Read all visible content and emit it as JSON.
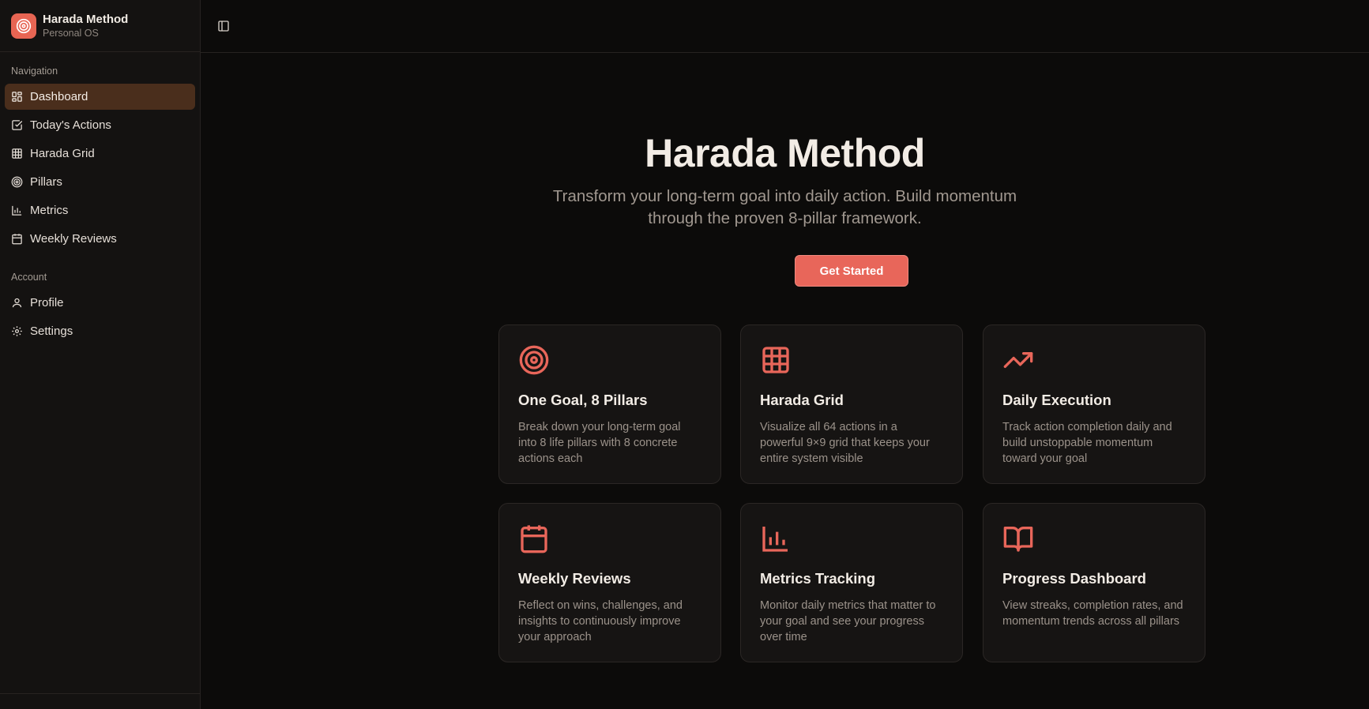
{
  "brand": {
    "title": "Harada Method",
    "subtitle": "Personal OS"
  },
  "sidebar": {
    "navigation_label": "Navigation",
    "navigation": [
      {
        "label": "Dashboard",
        "icon": "dashboard-icon",
        "active": true
      },
      {
        "label": "Today's Actions",
        "icon": "check-square-icon"
      },
      {
        "label": "Harada Grid",
        "icon": "grid-icon"
      },
      {
        "label": "Pillars",
        "icon": "target-icon"
      },
      {
        "label": "Metrics",
        "icon": "bar-chart-icon"
      },
      {
        "label": "Weekly Reviews",
        "icon": "calendar-icon"
      }
    ],
    "account_label": "Account",
    "account": [
      {
        "label": "Profile",
        "icon": "user-icon"
      },
      {
        "label": "Settings",
        "icon": "gear-icon"
      }
    ]
  },
  "hero": {
    "title": "Harada Method",
    "subtitle": "Transform your long-term goal into daily action. Build momentum through the proven 8-pillar framework.",
    "cta": "Get Started"
  },
  "features": [
    {
      "title": "One Goal, 8 Pillars",
      "desc": "Break down your long-term goal into 8 life pillars with 8 concrete actions each",
      "icon": "target-icon"
    },
    {
      "title": "Harada Grid",
      "desc": "Visualize all 64 actions in a powerful 9×9 grid that keeps your entire system visible",
      "icon": "grid-icon"
    },
    {
      "title": "Daily Execution",
      "desc": "Track action completion daily and build unstoppable momentum toward your goal",
      "icon": "trending-up-icon"
    },
    {
      "title": "Weekly Reviews",
      "desc": "Reflect on wins, challenges, and insights to continuously improve your approach",
      "icon": "calendar-icon"
    },
    {
      "title": "Metrics Tracking",
      "desc": "Monitor daily metrics that matter to your goal and see your progress over time",
      "icon": "bar-chart-icon"
    },
    {
      "title": "Progress Dashboard",
      "desc": "View streaks, completion rates, and momentum trends across all pillars",
      "icon": "book-open-icon"
    }
  ],
  "colors": {
    "accent": "#e8665a",
    "active_nav": "#4a2e1c",
    "background": "#0c0b0a"
  }
}
